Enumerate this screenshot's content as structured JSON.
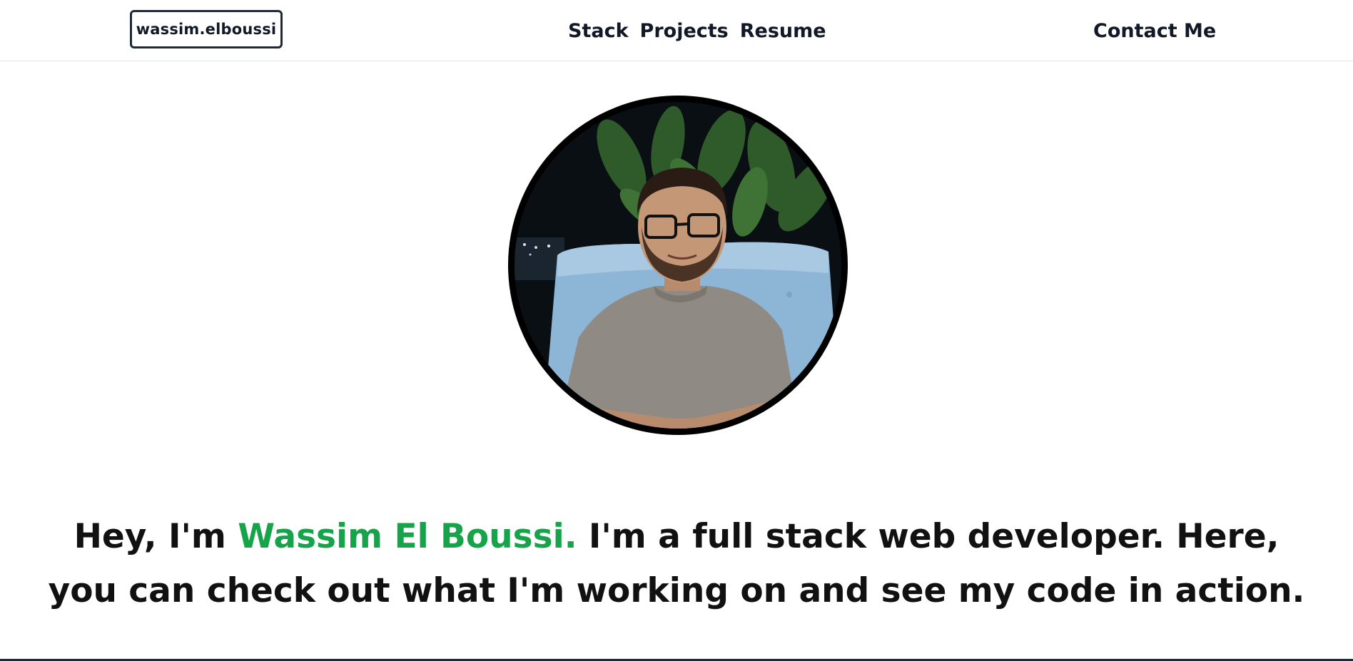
{
  "navbar": {
    "brand": "wassim.elboussi",
    "links": [
      {
        "label": "Stack"
      },
      {
        "label": "Projects"
      },
      {
        "label": "Resume"
      }
    ],
    "contact_label": "Contact Me"
  },
  "hero": {
    "intro_prefix": "Hey, I'm ",
    "name": "Wassim El Boussi.",
    "intro_suffix": " I'm a full stack web developer. Here, you can check out what I'm working on and see my code in action."
  },
  "colors": {
    "accent": "#16a34a",
    "text": "#111827",
    "background": "#ffffff"
  }
}
